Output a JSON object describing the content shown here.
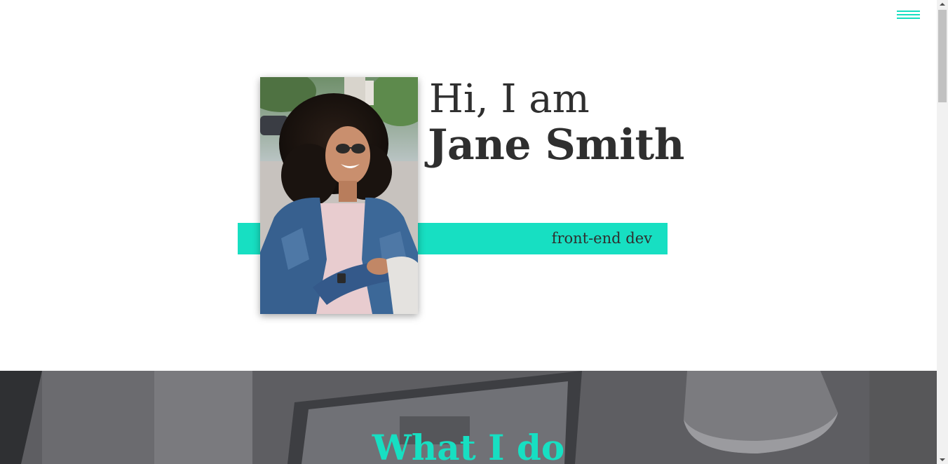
{
  "nav": {
    "menu_icon": "hamburger-menu-icon",
    "accent_color": "#17dfc2"
  },
  "hero": {
    "greeting": "Hi, I am",
    "name": "Jane Smith",
    "role": "front-end dev",
    "photo_alt": "Portrait photo",
    "band_color": "#17dfc2",
    "text_color": "#2f2f2f"
  },
  "services": {
    "title": "What I do",
    "background_color": "#5d5d61"
  }
}
